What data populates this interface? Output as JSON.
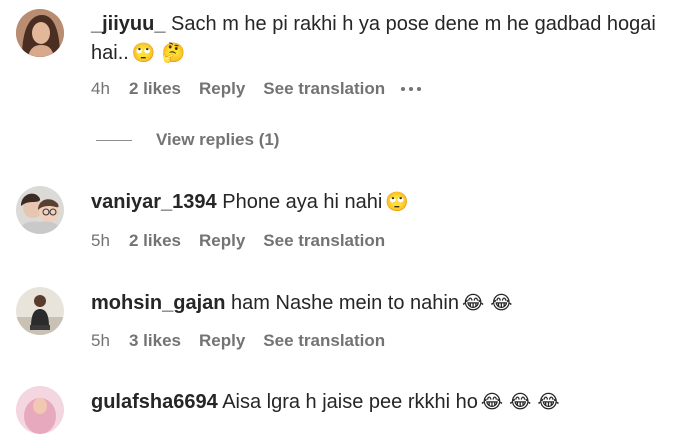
{
  "comments": [
    {
      "username": "_jiiyuu_",
      "text": "Sach m he pi rakhi h ya pose dene m he gadbad hogai hai..",
      "emoji": "🙄 🤔",
      "time": "4h",
      "likes": "2 likes",
      "reply": "Reply",
      "translation": "See translation",
      "avatar_icon": "woman-portrait-avatar"
    },
    {
      "username": "vaniyar_1394",
      "text": "Phone aya hi nahi",
      "emoji": "🙄",
      "time": "5h",
      "likes": "2 likes",
      "reply": "Reply",
      "translation": "See translation",
      "avatar_icon": "two-people-avatar"
    },
    {
      "username": "mohsin_gajan",
      "text": "ham Nashe mein to nahin",
      "emoji": "😂 😂",
      "time": "5h",
      "likes": "3 likes",
      "reply": "Reply",
      "translation": "See translation",
      "avatar_icon": "man-sitting-avatar"
    },
    {
      "username": "gulafsha6694",
      "text": "Aisa lgra h jaise pee rkkhi ho",
      "emoji": "😂 😂 😂",
      "avatar_icon": "pink-avatar"
    }
  ],
  "view_replies": "View replies (1)",
  "more_icon": "ellipsis-icon",
  "colors": {
    "text": "#262626",
    "meta": "#737373",
    "background": "#ffffff"
  }
}
